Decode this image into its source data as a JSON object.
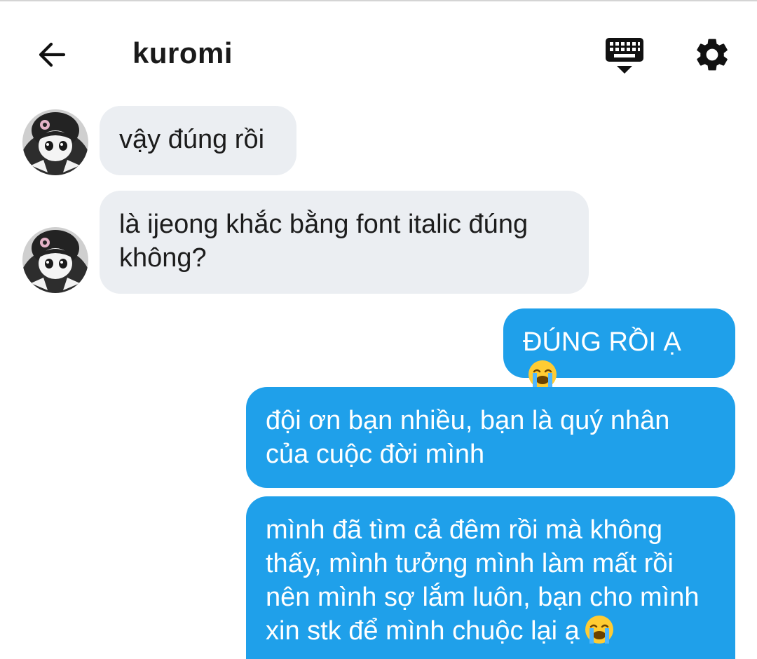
{
  "header": {
    "title": "kuromi",
    "back_icon": "arrow-left-icon",
    "keyboard_icon": "keyboard-icon",
    "settings_icon": "gear-icon"
  },
  "messages": [
    {
      "side": "incoming",
      "text": "vậy đúng rồi"
    },
    {
      "side": "incoming",
      "text": "là ijeong khắc bằng font italic đúng không?"
    },
    {
      "side": "outgoing",
      "text": "ĐÚNG RỒI Ạ",
      "emoji": "crying-face-icon"
    },
    {
      "side": "outgoing",
      "text": "đội ơn bạn nhiều, bạn là quý nhân của cuộc đời mình"
    },
    {
      "side": "outgoing",
      "text": "mình đã tìm cả đêm rồi mà không thấy, mình tưởng mình làm mất rồi nên mình sợ lắm luôn, bạn cho mình xin stk để mình chuộc lại ạ",
      "emoji": "crying-face-icon"
    }
  ],
  "colors": {
    "incoming_bubble": "#ebeef2",
    "outgoing_bubble": "#1fa0ea",
    "outgoing_text": "#ffffff",
    "incoming_text": "#1c1c1c"
  }
}
